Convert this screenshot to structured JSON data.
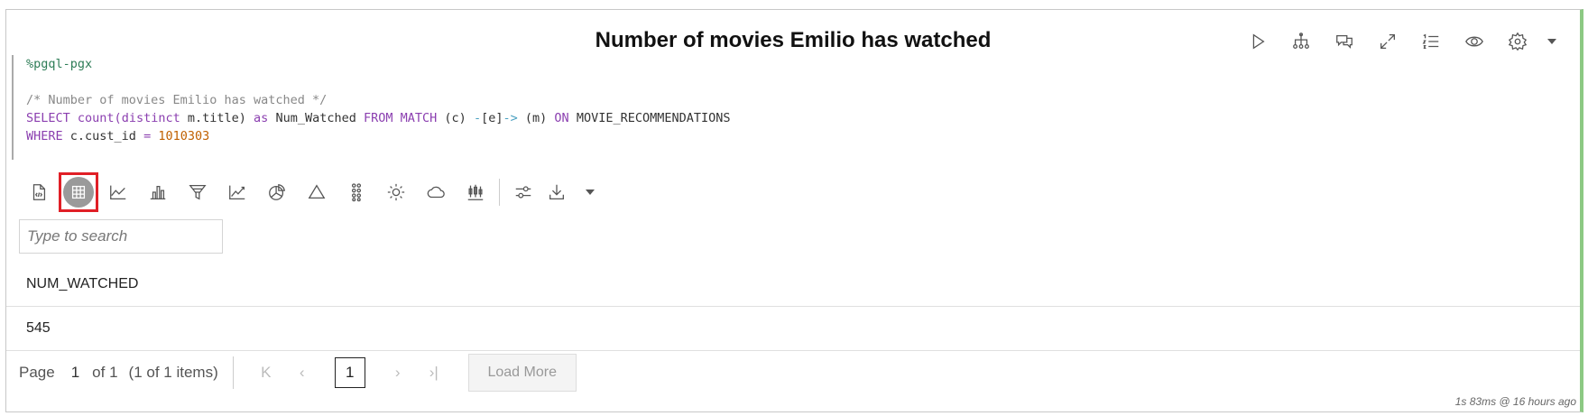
{
  "cell": {
    "title": "Number of movies Emilio has watched",
    "toolbar": {
      "run": "run-icon",
      "hierarchy": "hierarchy-icon",
      "comments": "comments-icon",
      "expand": "expand-icon",
      "list": "numbered-list-icon",
      "visibility": "eye-icon",
      "settings": "gear-icon"
    },
    "code": {
      "interpreter": "%pgql-pgx",
      "comment": "/* Number of movies Emilio has watched */",
      "line_select": {
        "select": "SELECT",
        "count": "count(distinct",
        "arg": "m.title)",
        "as": "as",
        "alias": "Num_Watched",
        "from": "FROM",
        "match": "MATCH",
        "pattern_a": "(c)",
        "arrow1": "-",
        "edge": "[e]",
        "arrow2": "->",
        "pattern_b": "(m)",
        "on": "ON",
        "graph": "MOVIE_RECOMMENDATIONS"
      },
      "line_where": {
        "where": "WHERE",
        "field": "c.cust_id",
        "op": "=",
        "value": "1010303"
      }
    },
    "viz_toolbar": [
      "code-file-icon",
      "table-icon",
      "area-chart-icon",
      "bar-chart-icon",
      "funnel-chart-icon",
      "line-chart-icon",
      "pie-chart-icon",
      "pyramid-icon",
      "scatter-icon",
      "sunburst-icon",
      "cloud-icon",
      "boxplot-icon",
      "settings-sliders-icon",
      "download-icon"
    ],
    "selected_viz": "table-icon",
    "search": {
      "placeholder": "Type to search"
    },
    "table": {
      "columns": [
        "NUM_WATCHED"
      ],
      "rows": [
        [
          "545"
        ]
      ]
    },
    "pager": {
      "page_label": "Page",
      "current_page": "1",
      "of_label": "of 1",
      "items_label": "(1 of 1 items)",
      "page_input": "1",
      "load_more": "Load More"
    },
    "timing": "1s 83ms @ 16 hours ago"
  }
}
